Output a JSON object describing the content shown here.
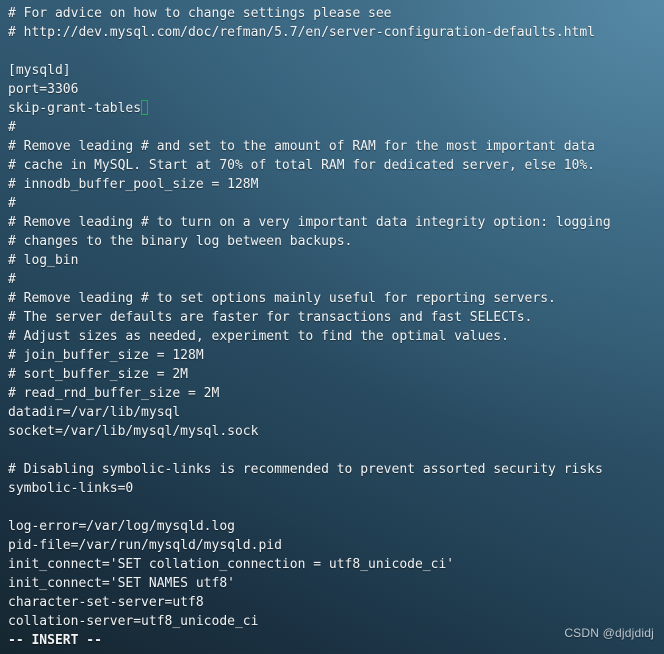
{
  "terminal": {
    "app": "vim",
    "file_type": "mysql-config",
    "colors": {
      "background_light": "#47748f",
      "background_dark": "#15262f",
      "foreground": "#f2f4f5",
      "cursor": "#19b24a",
      "watermark": "#dee6eb"
    },
    "cursor": {
      "line_index": 5,
      "column_char": 17,
      "shape": "hollow-block"
    },
    "status_line": "-- INSERT --",
    "lines": [
      "# For advice on how to change settings please see",
      "# http://dev.mysql.com/doc/refman/5.7/en/server-configuration-defaults.html",
      "",
      "[mysqld]",
      "port=3306",
      "skip-grant-tables",
      "#",
      "# Remove leading # and set to the amount of RAM for the most important data",
      "# cache in MySQL. Start at 70% of total RAM for dedicated server, else 10%.",
      "# innodb_buffer_pool_size = 128M",
      "#",
      "# Remove leading # to turn on a very important data integrity option: logging",
      "# changes to the binary log between backups.",
      "# log_bin",
      "#",
      "# Remove leading # to set options mainly useful for reporting servers.",
      "# The server defaults are faster for transactions and fast SELECTs.",
      "# Adjust sizes as needed, experiment to find the optimal values.",
      "# join_buffer_size = 128M",
      "# sort_buffer_size = 2M",
      "# read_rnd_buffer_size = 2M",
      "datadir=/var/lib/mysql",
      "socket=/var/lib/mysql/mysql.sock",
      "",
      "# Disabling symbolic-links is recommended to prevent assorted security risks",
      "symbolic-links=0",
      "",
      "log-error=/var/log/mysqld.log",
      "pid-file=/var/run/mysqld/mysqld.pid",
      "init_connect='SET collation_connection = utf8_unicode_ci'",
      "init_connect='SET NAMES utf8'",
      "character-set-server=utf8",
      "collation-server=utf8_unicode_ci"
    ]
  },
  "watermark": {
    "text": "CSDN @djdjdidj"
  }
}
